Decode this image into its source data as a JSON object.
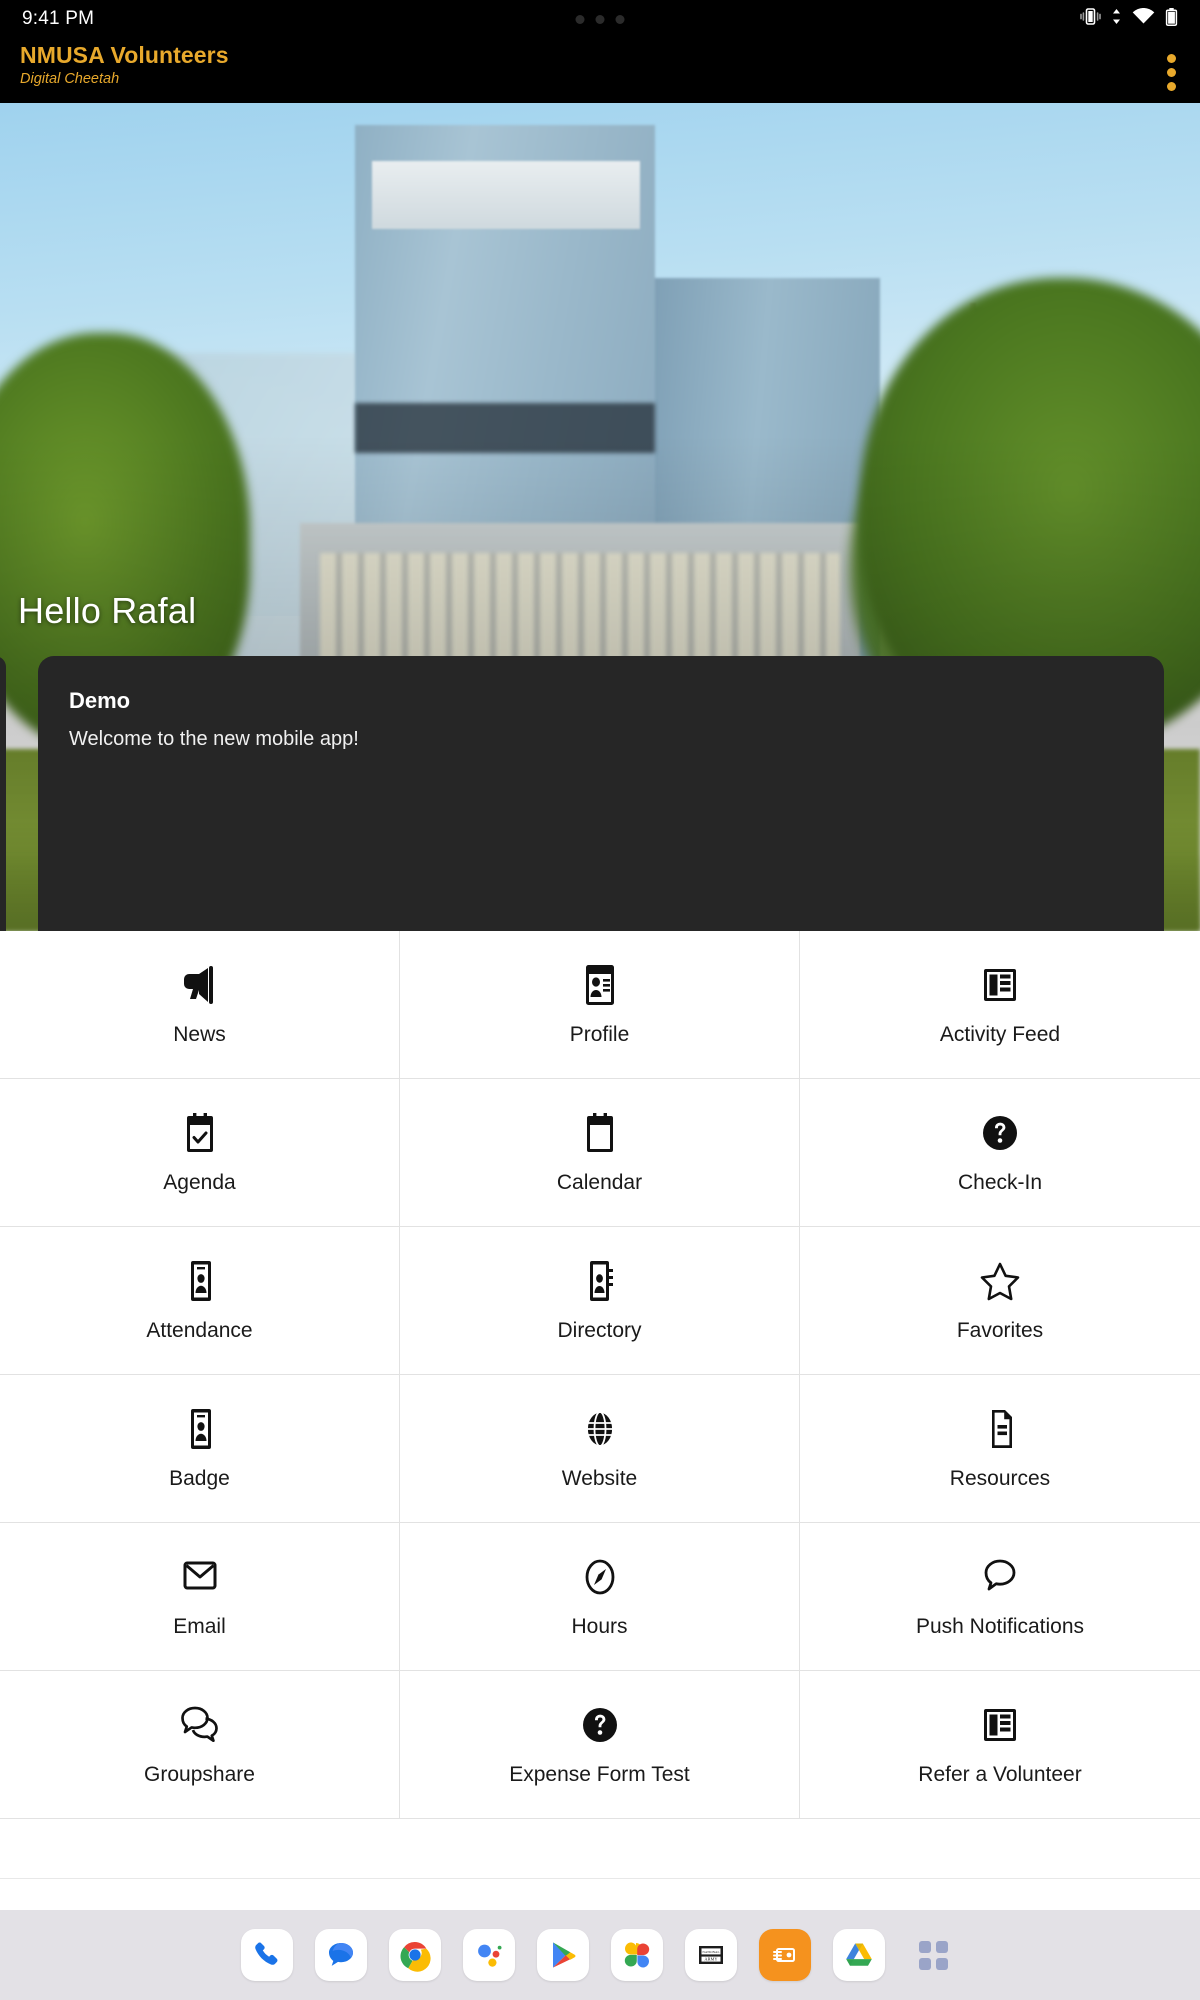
{
  "status_bar": {
    "time": "9:41 PM",
    "icons": [
      "vibrate-icon",
      "data-transfer-icon",
      "wifi-icon",
      "battery-icon"
    ]
  },
  "app_bar": {
    "title": "NMUSA Volunteers",
    "subtitle": "Digital Cheetah",
    "overflow_menu": "overflow-menu-icon",
    "accent_color": "#e8a92c",
    "background_color": "#000000"
  },
  "hero": {
    "greeting": "Hello Rafal",
    "card": {
      "title": "Demo",
      "body": "Welcome to the new mobile app!",
      "background_color": "#262626"
    },
    "page_indicator": {
      "total": 2,
      "active_index": 1
    }
  },
  "grid": {
    "tiles": [
      {
        "label": "News",
        "icon": "megaphone-icon"
      },
      {
        "label": "Profile",
        "icon": "id-card-icon"
      },
      {
        "label": "Activity Feed",
        "icon": "newspaper-icon"
      },
      {
        "label": "Agenda",
        "icon": "calendar-check-icon"
      },
      {
        "label": "Calendar",
        "icon": "calendar-icon"
      },
      {
        "label": "Check-In",
        "icon": "question-circle-icon"
      },
      {
        "label": "Attendance",
        "icon": "contact-card-icon"
      },
      {
        "label": "Directory",
        "icon": "address-book-icon"
      },
      {
        "label": "Favorites",
        "icon": "star-icon"
      },
      {
        "label": "Badge",
        "icon": "badge-icon"
      },
      {
        "label": "Website",
        "icon": "globe-icon"
      },
      {
        "label": "Resources",
        "icon": "document-icon"
      },
      {
        "label": "Email",
        "icon": "envelope-icon"
      },
      {
        "label": "Hours",
        "icon": "compass-icon"
      },
      {
        "label": "Push Notifications",
        "icon": "speech-bubble-icon"
      },
      {
        "label": "Groupshare",
        "icon": "chat-bubbles-icon"
      },
      {
        "label": "Expense Form Test",
        "icon": "question-circle-icon"
      },
      {
        "label": "Refer a Volunteer",
        "icon": "newspaper-icon"
      }
    ]
  },
  "dock": {
    "apps": [
      {
        "name": "phone-app-icon"
      },
      {
        "name": "messages-app-icon"
      },
      {
        "name": "chrome-app-icon"
      },
      {
        "name": "google-assistant-app-icon"
      },
      {
        "name": "play-store-app-icon"
      },
      {
        "name": "google-photos-app-icon"
      },
      {
        "name": "national-museum-army-app-icon",
        "label": "NATIONAL MUSEUM UNITED STATES ARMY"
      },
      {
        "name": "orange-app-icon"
      },
      {
        "name": "google-drive-app-icon"
      },
      {
        "name": "all-apps-icon"
      }
    ]
  }
}
